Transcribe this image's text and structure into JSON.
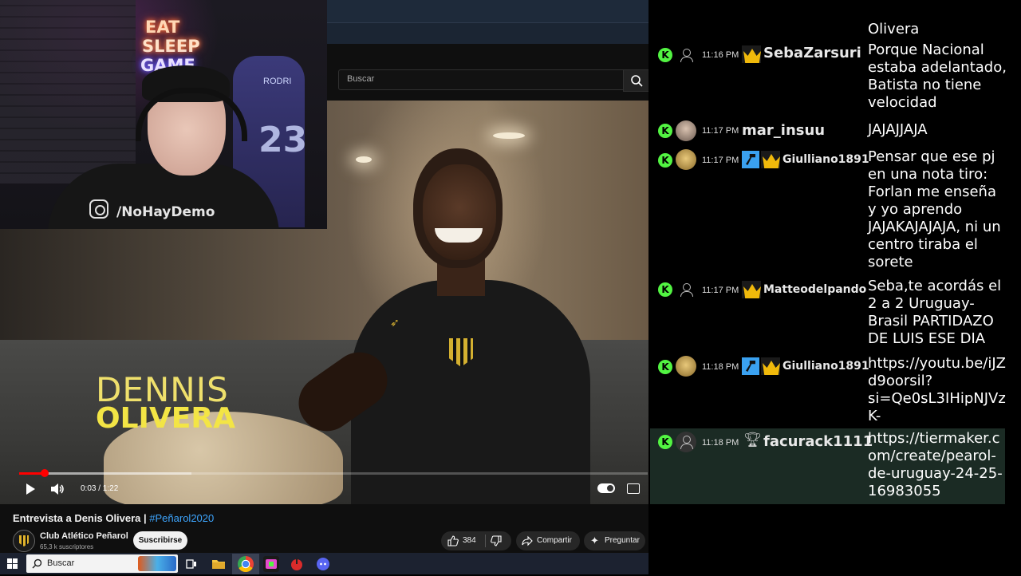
{
  "browser": {
    "search_placeholder": "Buscar"
  },
  "video": {
    "overlay_line1": "DENNIS",
    "overlay_line2": "OLIVERA",
    "time_display": "0:03 / 1:22",
    "progress_fraction": 0.04,
    "title": "Entrevista a Denis Olivera | ",
    "title_tag": "#Peñarol2020"
  },
  "channel": {
    "name": "Club Atlético Peñarol",
    "subscribers": "65,3 k suscriptores",
    "subscribe_label": "Suscribirse"
  },
  "actions": {
    "likes": "384",
    "share_label": "Compartir",
    "ask_label": "Preguntar"
  },
  "webcam": {
    "neon_line1": "EAT",
    "neon_line2": "SLEEP",
    "neon_line3": "GAME",
    "jersey_name": "RODRI",
    "jersey_number": "23",
    "watermark": "/NoHayDemo"
  },
  "chat": {
    "top_cut_text": "Olivera",
    "messages": [
      {
        "time": "11:16 PM",
        "user": "SebaZarsuri",
        "text": "Porque Nacional estaba adelantado, Batista no tiene velocidad",
        "avatar": "ghost",
        "badges": [
          "crown"
        ]
      },
      {
        "time": "11:17 PM",
        "user": "mar_insuu",
        "text": "JAJAJJAJA",
        "avatar": "photo",
        "badges": []
      },
      {
        "time": "11:17 PM",
        "user": "Giulliano1891",
        "text": "Pensar que ese pj en una nota tiro: Forlan me enseña y yo aprendo JAJAKAJAJAJA, ni un centro tiraba el sorete",
        "avatar": "photo",
        "badges": [
          "hammer",
          "crown"
        ]
      },
      {
        "time": "11:17 PM",
        "user": "Matteodelpando",
        "text": "Seba,te acordás el 2 a 2 Uruguay-Brasil PARTIDAZO DE LUIS ESE DIA",
        "avatar": "ghost",
        "badges": [
          "crown"
        ]
      },
      {
        "time": "11:18 PM",
        "user": "Giulliano1891",
        "text": "https://youtu.be/iJZd9oorsil?si=Qe0sL3IHipNJVzK-",
        "avatar": "photo",
        "badges": [
          "hammer",
          "crown"
        ]
      },
      {
        "time": "11:18 PM",
        "user": "facurack1111",
        "text": "https://tiermaker.com/create/pearol-de-uruguay-24-25-16983055",
        "avatar": "ghost",
        "badges": [
          "trophy"
        ]
      }
    ]
  },
  "taskbar": {
    "search_label": "Buscar"
  },
  "colors": {
    "kick_green": "#52f442",
    "crown_gold": "#f0b90b",
    "mod_blue": "#3aa1f0",
    "yt_red": "#ff0000",
    "title_yellow": "#f3e545",
    "link_blue": "#3ea6ff"
  }
}
